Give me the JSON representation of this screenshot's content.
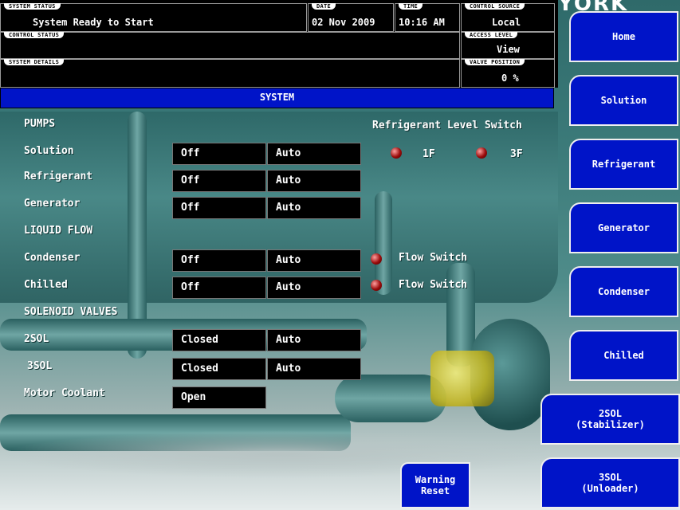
{
  "header": {
    "system_status_tag": "SYSTEM STATUS",
    "system_status": "System Ready to Start",
    "date_tag": "DATE",
    "date": "02 Nov 2009",
    "time_tag": "TIME",
    "time": "10:16 AM",
    "control_source_tag": "CONTROL SOURCE",
    "control_source": "Local",
    "control_status_tag": "CONTROL STATUS",
    "control_status": "",
    "access_level_tag": "ACCESS LEVEL",
    "access_level": "View",
    "system_details_tag": "SYSTEM DETAILS",
    "system_details": "",
    "valve_position_tag": "VALVE POSITION",
    "valve_position": "0 %",
    "logo": "YORK"
  },
  "section_title": "SYSTEM",
  "nav": {
    "home": "Home",
    "solution": "Solution",
    "refrigerant": "Refrigerant",
    "generator": "Generator",
    "condenser": "Condenser",
    "chilled": "Chilled",
    "sol2_line1": "2SOL",
    "sol2_line2": "(Stabilizer)",
    "sol3_line1": "3SOL",
    "sol3_line2": "(Unloader)"
  },
  "pumps": {
    "heading": "PUMPS",
    "rows": [
      {
        "label": "Solution",
        "state": "Off",
        "mode": "Auto"
      },
      {
        "label": "Refrigerant",
        "state": "Off",
        "mode": "Auto"
      },
      {
        "label": "Generator",
        "state": "Off",
        "mode": "Auto"
      }
    ]
  },
  "refrigerant_level": {
    "heading": "Refrigerant Level Switch",
    "switch_1": "1F",
    "switch_2": "3F"
  },
  "liquid_flow": {
    "heading": "LIQUID FLOW",
    "rows": [
      {
        "label": "Condenser",
        "state": "Off",
        "mode": "Auto",
        "switch": "Flow Switch"
      },
      {
        "label": "Chilled",
        "state": "Off",
        "mode": "Auto",
        "switch": "Flow Switch"
      }
    ]
  },
  "solenoid_valves": {
    "heading": "SOLENOID VALVES",
    "rows": [
      {
        "label": "2SOL",
        "state": "Closed",
        "mode": "Auto"
      },
      {
        "label": "3SOL",
        "state": "Closed",
        "mode": "Auto"
      }
    ]
  },
  "motor_coolant": {
    "label": "Motor Coolant",
    "state": "Open"
  },
  "warning_reset": {
    "line1": "Warning",
    "line2": "Reset"
  },
  "colors": {
    "button_blue": "#0014c8",
    "led_red": "#9b0b0b"
  }
}
